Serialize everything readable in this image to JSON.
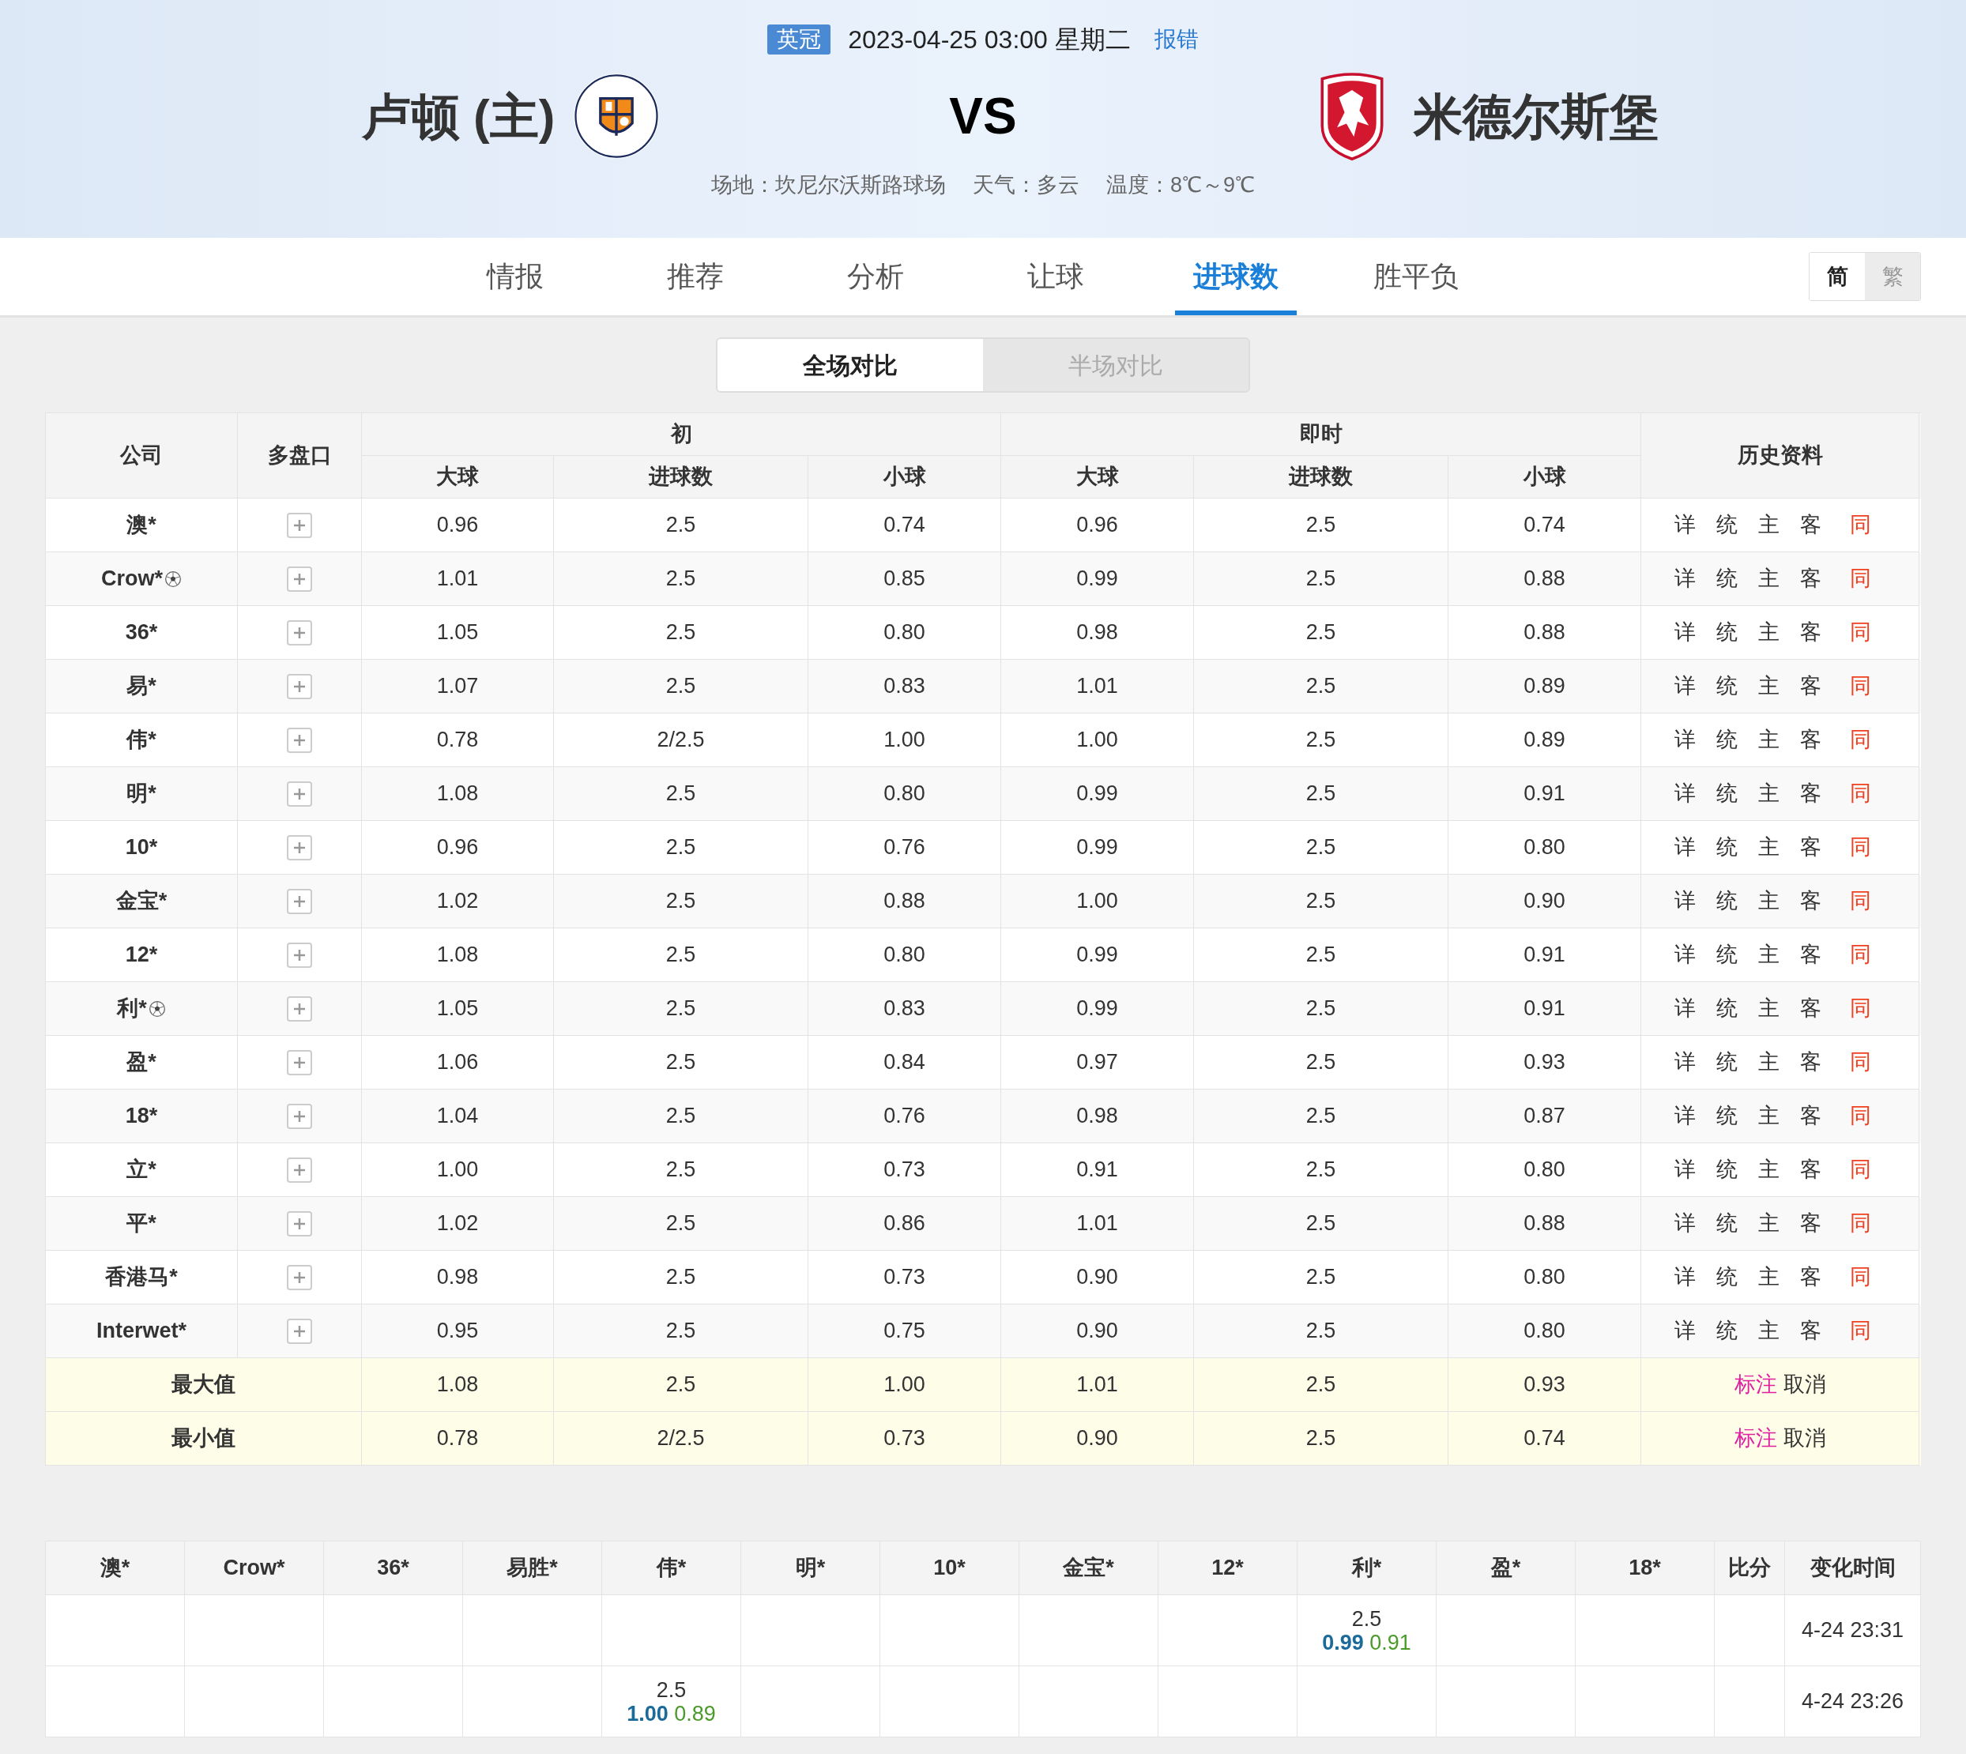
{
  "match": {
    "league": "英冠",
    "datetime": "2023-04-25 03:00 星期二",
    "report_link": "报错",
    "home": "卢顿 (主)",
    "vs": "VS",
    "away": "米德尔斯堡",
    "venue": "场地：坎尼尔沃斯路球场",
    "weather": "天气：多云",
    "temperature": "温度：8℃～9℃"
  },
  "tabs": [
    {
      "label": "情报",
      "selected": false
    },
    {
      "label": "推荐",
      "selected": false
    },
    {
      "label": "分析",
      "selected": false
    },
    {
      "label": "让球",
      "selected": false
    },
    {
      "label": "进球数",
      "selected": true
    },
    {
      "label": "胜平负",
      "selected": false
    }
  ],
  "script_toggle": [
    {
      "label": "简",
      "selected": true
    },
    {
      "label": "繁",
      "selected": false
    }
  ],
  "compare_toggle": [
    {
      "label": "全场对比",
      "selected": true
    },
    {
      "label": "半场对比",
      "selected": false
    }
  ],
  "odds_table": {
    "columns": {
      "company": "公司",
      "multi": "多盘口",
      "initial": "初",
      "live": "即时",
      "history": "历史资料",
      "sub": [
        "大球",
        "进球数",
        "小球",
        "大球",
        "进球数",
        "小球"
      ]
    },
    "rows": [
      {
        "company": "澳*",
        "ball": false,
        "values": [
          "0.96",
          "2.5",
          "0.74",
          "0.96",
          "2.5",
          "0.74"
        ],
        "history": [
          {
            "label": "详",
            "highlight": false
          },
          {
            "label": "统",
            "highlight": false
          },
          {
            "label": "主",
            "highlight": false
          },
          {
            "label": "客",
            "highlight": false
          },
          {
            "label": "同",
            "highlight": true
          }
        ]
      },
      {
        "company": "Crow*",
        "ball": true,
        "values": [
          "1.01",
          "2.5",
          "0.85",
          "0.99",
          "2.5",
          "0.88"
        ],
        "history": [
          {
            "label": "详",
            "highlight": false
          },
          {
            "label": "统",
            "highlight": false
          },
          {
            "label": "主",
            "highlight": false
          },
          {
            "label": "客",
            "highlight": false
          },
          {
            "label": "同",
            "highlight": true
          }
        ]
      },
      {
        "company": "36*",
        "ball": false,
        "values": [
          "1.05",
          "2.5",
          "0.80",
          "0.98",
          "2.5",
          "0.88"
        ],
        "history": [
          {
            "label": "详",
            "highlight": false
          },
          {
            "label": "统",
            "highlight": false
          },
          {
            "label": "主",
            "highlight": false
          },
          {
            "label": "客",
            "highlight": false
          },
          {
            "label": "同",
            "highlight": true
          }
        ]
      },
      {
        "company": "易*",
        "ball": false,
        "values": [
          "1.07",
          "2.5",
          "0.83",
          "1.01",
          "2.5",
          "0.89"
        ],
        "history": [
          {
            "label": "详",
            "highlight": false
          },
          {
            "label": "统",
            "highlight": false
          },
          {
            "label": "主",
            "highlight": false
          },
          {
            "label": "客",
            "highlight": false
          },
          {
            "label": "同",
            "highlight": true
          }
        ]
      },
      {
        "company": "伟*",
        "ball": false,
        "values": [
          "0.78",
          "2/2.5",
          "1.00",
          "1.00",
          "2.5",
          "0.89"
        ],
        "history": [
          {
            "label": "详",
            "highlight": false
          },
          {
            "label": "统",
            "highlight": false
          },
          {
            "label": "主",
            "highlight": false
          },
          {
            "label": "客",
            "highlight": false
          },
          {
            "label": "同",
            "highlight": true
          }
        ]
      },
      {
        "company": "明*",
        "ball": false,
        "values": [
          "1.08",
          "2.5",
          "0.80",
          "0.99",
          "2.5",
          "0.91"
        ],
        "history": [
          {
            "label": "详",
            "highlight": false
          },
          {
            "label": "统",
            "highlight": false
          },
          {
            "label": "主",
            "highlight": false
          },
          {
            "label": "客",
            "highlight": false
          },
          {
            "label": "同",
            "highlight": true
          }
        ]
      },
      {
        "company": "10*",
        "ball": false,
        "values": [
          "0.96",
          "2.5",
          "0.76",
          "0.99",
          "2.5",
          "0.80"
        ],
        "history": [
          {
            "label": "详",
            "highlight": false
          },
          {
            "label": "统",
            "highlight": false
          },
          {
            "label": "主",
            "highlight": false
          },
          {
            "label": "客",
            "highlight": false
          },
          {
            "label": "同",
            "highlight": true
          }
        ]
      },
      {
        "company": "金宝*",
        "ball": false,
        "values": [
          "1.02",
          "2.5",
          "0.88",
          "1.00",
          "2.5",
          "0.90"
        ],
        "history": [
          {
            "label": "详",
            "highlight": false
          },
          {
            "label": "统",
            "highlight": false
          },
          {
            "label": "主",
            "highlight": false
          },
          {
            "label": "客",
            "highlight": false
          },
          {
            "label": "同",
            "highlight": true
          }
        ]
      },
      {
        "company": "12*",
        "ball": false,
        "values": [
          "1.08",
          "2.5",
          "0.80",
          "0.99",
          "2.5",
          "0.91"
        ],
        "history": [
          {
            "label": "详",
            "highlight": false
          },
          {
            "label": "统",
            "highlight": false
          },
          {
            "label": "主",
            "highlight": false
          },
          {
            "label": "客",
            "highlight": false
          },
          {
            "label": "同",
            "highlight": true
          }
        ]
      },
      {
        "company": "利*",
        "ball": true,
        "values": [
          "1.05",
          "2.5",
          "0.83",
          "0.99",
          "2.5",
          "0.91"
        ],
        "history": [
          {
            "label": "详",
            "highlight": false
          },
          {
            "label": "统",
            "highlight": false
          },
          {
            "label": "主",
            "highlight": false
          },
          {
            "label": "客",
            "highlight": false
          },
          {
            "label": "同",
            "highlight": true
          }
        ]
      },
      {
        "company": "盈*",
        "ball": false,
        "values": [
          "1.06",
          "2.5",
          "0.84",
          "0.97",
          "2.5",
          "0.93"
        ],
        "history": [
          {
            "label": "详",
            "highlight": false
          },
          {
            "label": "统",
            "highlight": false
          },
          {
            "label": "主",
            "highlight": false
          },
          {
            "label": "客",
            "highlight": false
          },
          {
            "label": "同",
            "highlight": true
          }
        ]
      },
      {
        "company": "18*",
        "ball": false,
        "values": [
          "1.04",
          "2.5",
          "0.76",
          "0.98",
          "2.5",
          "0.87"
        ],
        "history": [
          {
            "label": "详",
            "highlight": false
          },
          {
            "label": "统",
            "highlight": false
          },
          {
            "label": "主",
            "highlight": false
          },
          {
            "label": "客",
            "highlight": false
          },
          {
            "label": "同",
            "highlight": true
          }
        ]
      },
      {
        "company": "立*",
        "ball": false,
        "values": [
          "1.00",
          "2.5",
          "0.73",
          "0.91",
          "2.5",
          "0.80"
        ],
        "history": [
          {
            "label": "详",
            "highlight": false
          },
          {
            "label": "统",
            "highlight": false
          },
          {
            "label": "主",
            "highlight": false
          },
          {
            "label": "客",
            "highlight": false
          },
          {
            "label": "同",
            "highlight": true
          }
        ]
      },
      {
        "company": "平*",
        "ball": false,
        "values": [
          "1.02",
          "2.5",
          "0.86",
          "1.01",
          "2.5",
          "0.88"
        ],
        "history": [
          {
            "label": "详",
            "highlight": false
          },
          {
            "label": "统",
            "highlight": false
          },
          {
            "label": "主",
            "highlight": false
          },
          {
            "label": "客",
            "highlight": false
          },
          {
            "label": "同",
            "highlight": true
          }
        ]
      },
      {
        "company": "香港马*",
        "ball": false,
        "values": [
          "0.98",
          "2.5",
          "0.73",
          "0.90",
          "2.5",
          "0.80"
        ],
        "history": [
          {
            "label": "详",
            "highlight": false
          },
          {
            "label": "统",
            "highlight": false
          },
          {
            "label": "主",
            "highlight": false
          },
          {
            "label": "客",
            "highlight": false
          },
          {
            "label": "同",
            "highlight": true
          }
        ]
      },
      {
        "company": "Interwet*",
        "ball": false,
        "values": [
          "0.95",
          "2.5",
          "0.75",
          "0.90",
          "2.5",
          "0.80"
        ],
        "history": [
          {
            "label": "详",
            "highlight": false
          },
          {
            "label": "统",
            "highlight": false
          },
          {
            "label": "主",
            "highlight": false
          },
          {
            "label": "客",
            "highlight": false
          },
          {
            "label": "同",
            "highlight": true
          }
        ]
      }
    ],
    "summary": [
      {
        "label": "最大值",
        "values": [
          "1.08",
          "2.5",
          "1.00",
          "1.01",
          "2.5",
          "0.93"
        ],
        "actions": [
          {
            "label": "标注",
            "kind": "mark"
          },
          {
            "label": "取消",
            "kind": "plain"
          }
        ]
      },
      {
        "label": "最小值",
        "values": [
          "0.78",
          "2/2.5",
          "0.73",
          "0.90",
          "2.5",
          "0.74"
        ],
        "actions": [
          {
            "label": "标注",
            "kind": "mark"
          },
          {
            "label": "取消",
            "kind": "plain"
          }
        ]
      }
    ]
  },
  "change_table": {
    "columns": [
      "澳*",
      "Crow*",
      "36*",
      "易胜*",
      "伟*",
      "明*",
      "10*",
      "金宝*",
      "12*",
      "利*",
      "盈*",
      "18*",
      "比分",
      "变化时间"
    ],
    "rows": [
      {
        "cells": [
          null,
          null,
          null,
          null,
          null,
          null,
          null,
          null,
          null,
          {
            "line": "2.5",
            "over": "0.99",
            "under": "0.91"
          },
          null,
          null,
          null
        ],
        "time": "4-24 23:31"
      },
      {
        "cells": [
          null,
          null,
          null,
          null,
          {
            "line": "2.5",
            "over": "1.00",
            "under": "0.89"
          },
          null,
          null,
          null,
          null,
          null,
          null,
          null,
          null
        ],
        "time": "4-24 23:26"
      }
    ]
  }
}
